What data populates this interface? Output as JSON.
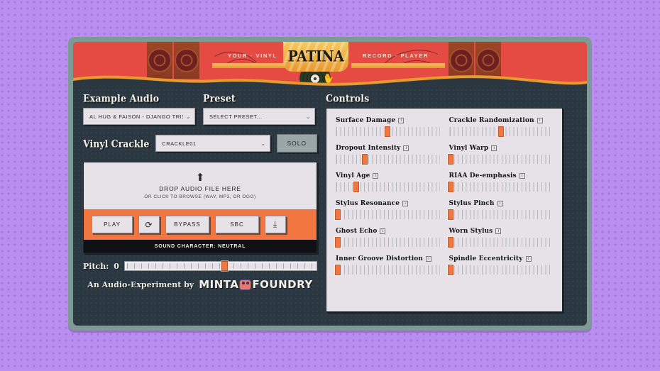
{
  "header": {
    "left_word": "YOUR · VINYL",
    "logo": "PATINA",
    "right_word": "RECORD · PLAYER",
    "record_icon": "vinyl-record-icon",
    "speaker_icon": "speaker-icon"
  },
  "example_audio": {
    "title": "Example Audio",
    "selected": "AL HUG & FAISON - DJANGO TRISTE",
    "chevron": "⌄"
  },
  "preset": {
    "title": "Preset",
    "selected": "SELECT PRESET...",
    "chevron": "⌄"
  },
  "crackle": {
    "label": "Vinyl Crackle",
    "selected": "CRACKLE01",
    "chevron": "⌄",
    "solo_label": "SOLO"
  },
  "dropzone": {
    "upload_icon": "⬆",
    "title": "DROP AUDIO FILE HERE",
    "subtitle": "OR CLICK TO BROWSE (WAV, MP3, OR OGG)"
  },
  "transport": {
    "play_label": "PLAY",
    "loop_icon": "⟳",
    "bypass_label": "BYPASS",
    "sbc_label": "SBC",
    "download_icon": "⤓"
  },
  "character_bar": "SOUND CHARACTER: NEUTRAL",
  "pitch": {
    "label": "Pitch:",
    "value": "0",
    "position_pct": 52
  },
  "footer": {
    "text": "An Audio-Experiment by",
    "brand_a": "MINTA",
    "brand_b": "FOUNDRY",
    "mascot_icon": "mascot-icon"
  },
  "controls": {
    "title": "Controls",
    "info_glyph": "i",
    "items": [
      {
        "label": "Surface Damage",
        "position_pct": 50
      },
      {
        "label": "Crackle Randomization",
        "position_pct": 50
      },
      {
        "label": "Dropout Intensity",
        "position_pct": 28
      },
      {
        "label": "Vinyl Warp",
        "position_pct": 2
      },
      {
        "label": "Vinyl Age",
        "position_pct": 20
      },
      {
        "label": "RIAA De-emphasis",
        "position_pct": 2
      },
      {
        "label": "Stylus Resonance",
        "position_pct": 2
      },
      {
        "label": "Stylus Pinch",
        "position_pct": 2
      },
      {
        "label": "Ghost Echo",
        "position_pct": 2
      },
      {
        "label": "Worn Stylus",
        "position_pct": 2
      },
      {
        "label": "Inner Groove Distortion",
        "position_pct": 2
      },
      {
        "label": "Spindle Eccentricity",
        "position_pct": 2
      }
    ]
  },
  "colors": {
    "banner_red": "#e54b42",
    "accent_orange": "#f2763f",
    "gold": "#e8992f",
    "frame_green": "#7d9a94",
    "panel_dark": "#2b3841",
    "panel_light": "#e6e2e8",
    "page_purple": "#b98ef0"
  }
}
